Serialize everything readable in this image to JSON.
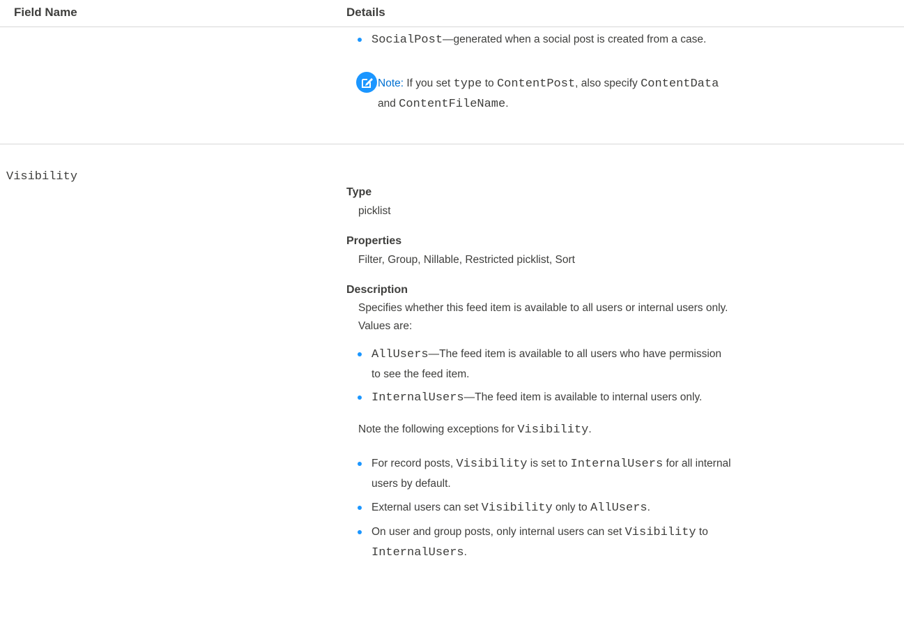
{
  "header": {
    "field_name": "Field Name",
    "details": "Details"
  },
  "row1": {
    "bullet": {
      "code": "SocialPost",
      "text": "—generated when a social post is created from a case."
    },
    "note": {
      "label": "Note:",
      "t1": " If you set ",
      "c1": "type",
      "t2": " to ",
      "c2": "ContentPost",
      "t3": ", also specify ",
      "c3": "ContentData",
      "t4": "and ",
      "c4": "ContentFileName",
      "t5": "."
    }
  },
  "row2": {
    "field_name": "Visibility",
    "type_label": "Type",
    "type_value": "picklist",
    "properties_label": "Properties",
    "properties_value": "Filter, Group, Nillable, Restricted picklist, Sort",
    "description_label": "Description",
    "description_line1": "Specifies whether this feed item is available to all users or internal users only.",
    "description_line2": "Values are:",
    "values": [
      {
        "code": "AllUsers",
        "text": "—The feed item is available to all users who have permission",
        "text2": "to see the feed item."
      },
      {
        "code": "InternalUsers",
        "text": "—The feed item is available to internal users only."
      }
    ],
    "exceptions_intro": "Note the following exceptions for ",
    "exceptions_code": "Visibility",
    "exceptions_end": ".",
    "exceptions": [
      {
        "t1": "For record posts, ",
        "c1": "Visibility",
        "t2": " is set to ",
        "c2": "InternalUsers",
        "t3": " for all internal",
        "t4": "users by default."
      },
      {
        "t1": "External users can set ",
        "c1": "Visibility",
        "t2": " only to ",
        "c2": "AllUsers",
        "t3": "."
      },
      {
        "t1": "On user and group posts, only internal users can set ",
        "c1": "Visibility",
        "t2": " to",
        "c2": "InternalUsers",
        "t3": "."
      }
    ]
  },
  "colors": {
    "accent": "#1b96ff",
    "note_label": "#0070d2",
    "border": "#d8d8d8"
  },
  "icons": {
    "note": "edit-note-icon",
    "bullet": "bullet-dot"
  }
}
